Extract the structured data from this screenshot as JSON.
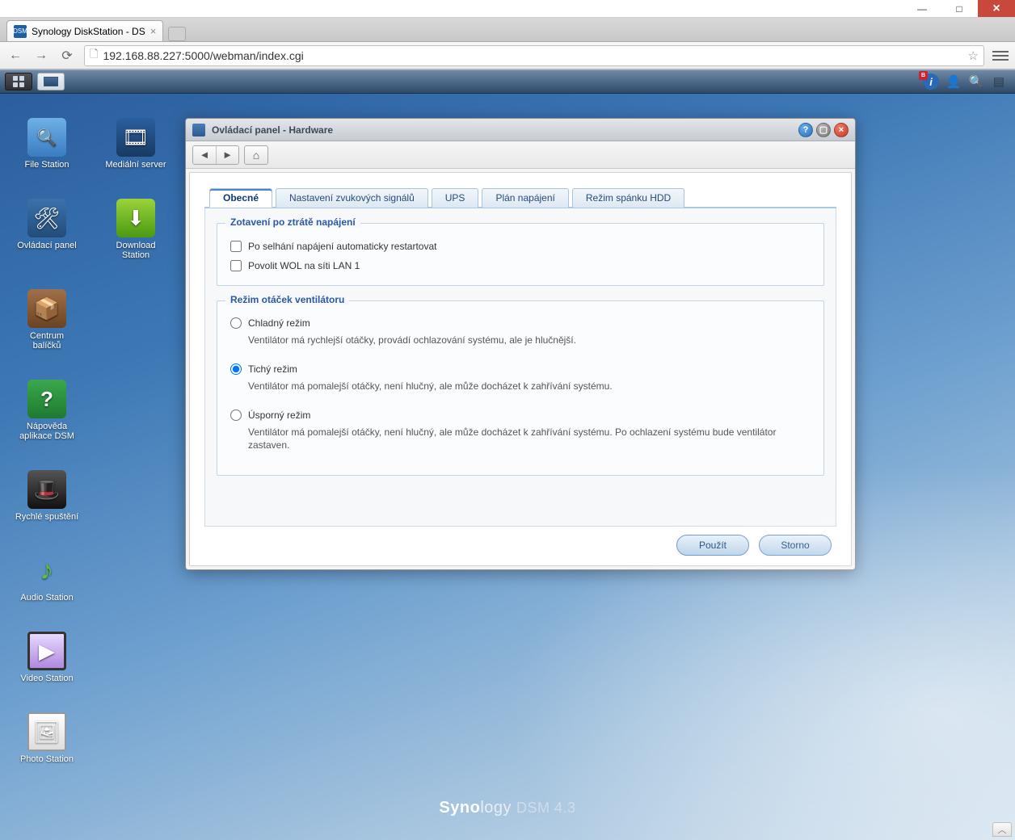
{
  "os": {
    "min": "—",
    "max": "□",
    "close": "×"
  },
  "browser": {
    "tab_title": "Synology DiskStation - DS",
    "favicon_text": "DSM",
    "url": "192.168.88.227:5000/webman/index.cgi"
  },
  "topbar": {
    "info_glyph": "i",
    "badge": "B"
  },
  "desktop": {
    "icons": [
      [
        {
          "name": "file-station",
          "label": "File Station",
          "cls": "folder",
          "glyph": ""
        },
        {
          "name": "media-server",
          "label": "Mediální server",
          "cls": "film",
          "glyph": "🎞"
        }
      ],
      [
        {
          "name": "control-panel",
          "label": "Ovládací panel",
          "cls": "panel",
          "glyph": "🛠"
        },
        {
          "name": "download-station",
          "label": "Download Station",
          "cls": "dl",
          "glyph": "⬇"
        }
      ],
      [
        {
          "name": "package-center",
          "label": "Centrum balíčků",
          "cls": "box",
          "glyph": "📦"
        }
      ],
      [
        {
          "name": "dsm-help",
          "label": "Nápověda aplikace DSM",
          "cls": "help",
          "glyph": "?"
        }
      ],
      [
        {
          "name": "quick-start",
          "label": "Rychlé spuštění",
          "cls": "hat",
          "glyph": "🎩"
        }
      ],
      [
        {
          "name": "audio-station",
          "label": "Audio Station",
          "cls": "note",
          "glyph": "♪"
        }
      ],
      [
        {
          "name": "video-station",
          "label": "Video Station",
          "cls": "vid",
          "glyph": "▶"
        }
      ],
      [
        {
          "name": "photo-station",
          "label": "Photo Station",
          "cls": "photo",
          "glyph": "🖼"
        }
      ]
    ],
    "brand_bold": "Syno",
    "brand_rest": "logy",
    "brand_suffix": "DSM 4.3"
  },
  "window": {
    "title": "Ovládací panel - Hardware",
    "tabs": [
      {
        "label": "Obecné",
        "active": true
      },
      {
        "label": "Nastavení zvukových signálů",
        "active": false
      },
      {
        "label": "UPS",
        "active": false
      },
      {
        "label": "Plán napájení",
        "active": false
      },
      {
        "label": "Režim spánku HDD",
        "active": false
      }
    ],
    "section_power": {
      "legend": "Zotavení po ztrátě napájení",
      "chk_restart": "Po selhání napájení automaticky restartovat",
      "chk_wol": "Povolit WOL na síti LAN 1"
    },
    "section_fan": {
      "legend": "Režim otáček ventilátoru",
      "opt_cool": "Chladný režim",
      "opt_cool_desc": "Ventilátor má rychlejší otáčky, provádí ochlazování systému, ale je hlučnější.",
      "opt_quiet": "Tichý režim",
      "opt_quiet_desc": "Ventilátor má pomalejší otáčky, není hlučný, ale může docházet k zahřívání systému.",
      "opt_eco": "Úsporný režim",
      "opt_eco_desc": "Ventilátor má pomalejší otáčky, není hlučný, ale může docházet k zahřívání systému. Po ochlazení systému bude ventilátor zastaven."
    },
    "buttons": {
      "apply": "Použít",
      "cancel": "Storno"
    }
  }
}
